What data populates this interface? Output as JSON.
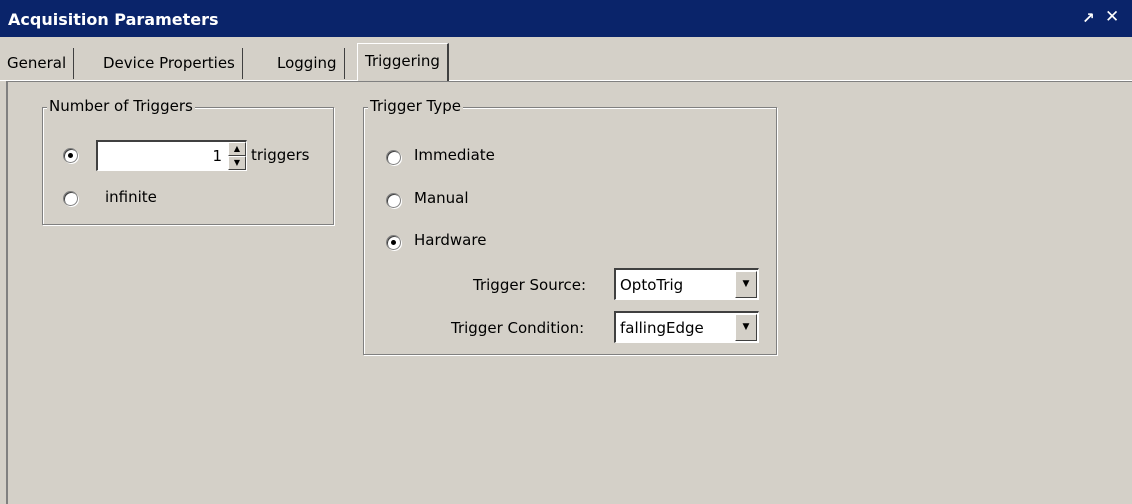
{
  "window": {
    "title": "Acquisition Parameters",
    "undock_icon": "↗",
    "close_icon": "✕"
  },
  "tabs": [
    {
      "label": "General"
    },
    {
      "label": "Device Properties"
    },
    {
      "label": "Logging"
    },
    {
      "label": "Triggering",
      "selected": true
    }
  ],
  "triggers_group": {
    "title": "Number of Triggers",
    "count_value": "1",
    "count_unit": "triggers",
    "infinite_label": "infinite",
    "selected": "count"
  },
  "trigger_type_group": {
    "title": "Trigger Type",
    "options": [
      {
        "label": "Immediate",
        "selected": false
      },
      {
        "label": "Manual",
        "selected": false
      },
      {
        "label": "Hardware",
        "selected": true
      }
    ],
    "source_label": "Trigger Source:",
    "source_value": "OptoTrig",
    "condition_label": "Trigger Condition:",
    "condition_value": "fallingEdge"
  },
  "colors": {
    "titlebar": "#0a246a",
    "face": "#d4d0c8"
  }
}
